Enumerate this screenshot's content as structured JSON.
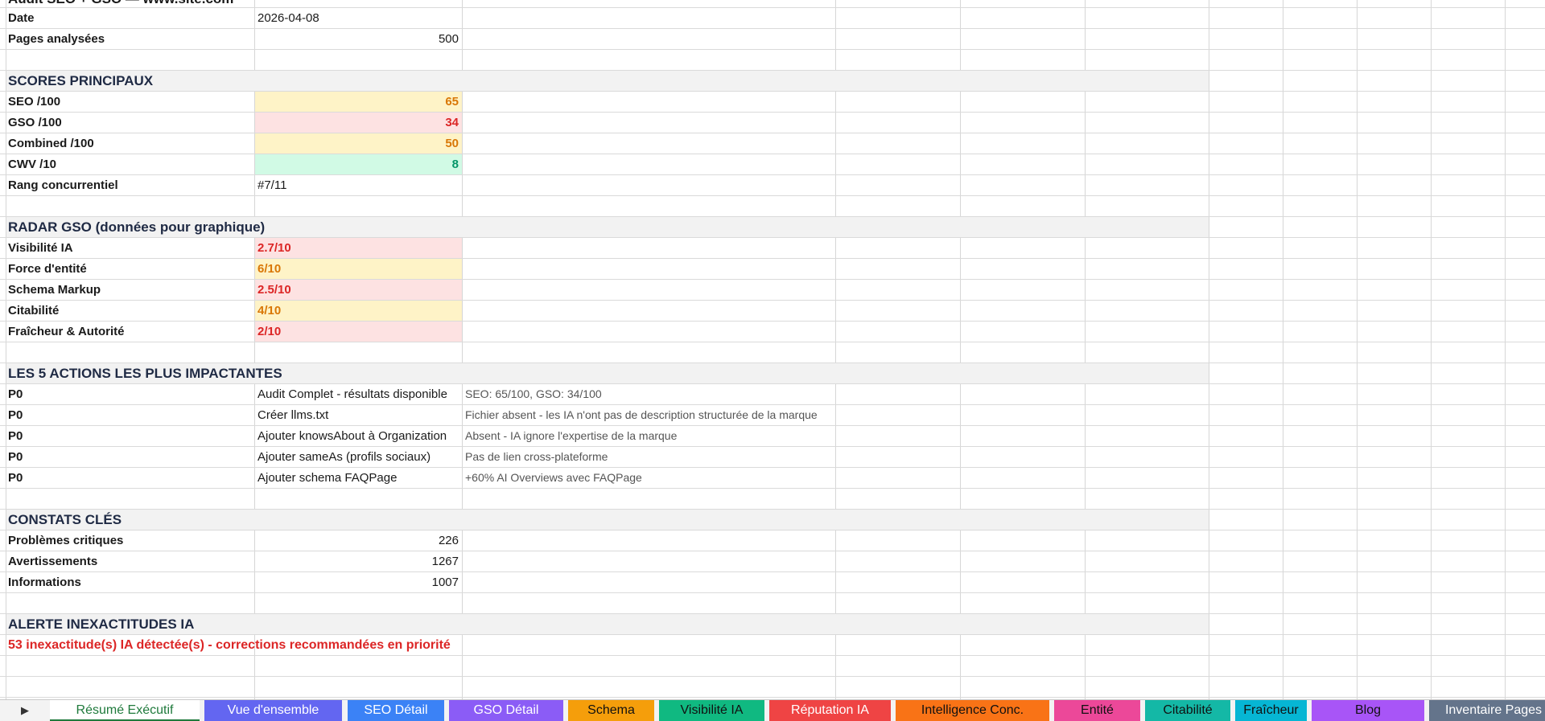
{
  "title_partial": "Audit SEO + GSO — www.site.com",
  "rows": {
    "date": {
      "label": "Date",
      "value": "2026-04-08"
    },
    "pages": {
      "label": "Pages analysées",
      "value": "500"
    },
    "scores_header": "SCORES PRINCIPAUX",
    "seo": {
      "label": "SEO /100",
      "value": "65"
    },
    "gso": {
      "label": "GSO /100",
      "value": "34"
    },
    "combined": {
      "label": "Combined /100",
      "value": "50"
    },
    "cwv": {
      "label": "CWV /10",
      "value": "8"
    },
    "rank": {
      "label": "Rang concurrentiel",
      "value": "#7/11"
    },
    "radar_header": "RADAR GSO (données pour graphique)",
    "radar": [
      {
        "label": "Visibilité IA",
        "value": "2.7/10"
      },
      {
        "label": "Force d'entité",
        "value": "6/10"
      },
      {
        "label": "Schema Markup",
        "value": "2.5/10"
      },
      {
        "label": "Citabilité",
        "value": "4/10"
      },
      {
        "label": "Fraîcheur & Autorité",
        "value": "2/10"
      }
    ],
    "actions_header": "LES 5 ACTIONS LES PLUS IMPACTANTES",
    "actions": [
      {
        "priority": "P0",
        "action": "Audit Complet - résultats disponible",
        "note": "SEO: 65/100, GSO: 34/100"
      },
      {
        "priority": "P0",
        "action": "Créer llms.txt",
        "note": "Fichier absent - les IA n'ont pas de description structurée de la marque"
      },
      {
        "priority": "P0",
        "action": "Ajouter knowsAbout à Organization",
        "note": "Absent - IA ignore l'expertise de la marque"
      },
      {
        "priority": "P0",
        "action": "Ajouter sameAs (profils sociaux)",
        "note": "Pas de lien cross-plateforme"
      },
      {
        "priority": "P0",
        "action": "Ajouter schema FAQPage",
        "note": "+60% AI Overviews avec FAQPage"
      }
    ],
    "findings_header": "CONSTATS CLÉS",
    "findings": [
      {
        "label": "Problèmes critiques",
        "value": "226"
      },
      {
        "label": "Avertissements",
        "value": "1267"
      },
      {
        "label": "Informations",
        "value": "1007"
      }
    ],
    "alert_header": "ALERTE INEXACTITUDES IA",
    "alert_text": "53 inexactitude(s) IA détectée(s) - corrections recommandées en priorité"
  },
  "tabs": [
    {
      "label": "Résumé Exécutif",
      "color": "#ffffff",
      "text": "#1f7a3c",
      "active": true
    },
    {
      "label": "Vue d'ensemble",
      "color": "#6366f1",
      "text": "#ffffff"
    },
    {
      "label": "SEO Détail",
      "color": "#3b82f6",
      "text": "#ffffff"
    },
    {
      "label": "GSO Détail",
      "color": "#8b5cf6",
      "text": "#ffffff"
    },
    {
      "label": "Schema",
      "color": "#f59e0b",
      "text": "#111111"
    },
    {
      "label": "Visibilité IA",
      "color": "#10b981",
      "text": "#111111"
    },
    {
      "label": "Réputation IA",
      "color": "#ef4444",
      "text": "#ffffff"
    },
    {
      "label": "Intelligence Conc.",
      "color": "#f97316",
      "text": "#111111"
    },
    {
      "label": "Entité",
      "color": "#ec4899",
      "text": "#111111"
    },
    {
      "label": "Citabilité",
      "color": "#14b8a6",
      "text": "#111111"
    },
    {
      "label": "Fraîcheur",
      "color": "#06b6d4",
      "text": "#111111"
    },
    {
      "label": "Blog",
      "color": "#a855f7",
      "text": "#111111"
    },
    {
      "label": "Inventaire Pages",
      "color": "#64748b",
      "text": "#ffffff"
    }
  ],
  "colors": {
    "section_bg": "#f2f2f2",
    "warn_bg": "#fef3c7",
    "warn_text": "#d97706",
    "bad_bg": "#fde2e2",
    "bad_text": "#dc2626",
    "good_bg": "#d1fae5",
    "good_text": "#059669"
  },
  "icons": {
    "scroll_right": "triangle-right-icon"
  }
}
